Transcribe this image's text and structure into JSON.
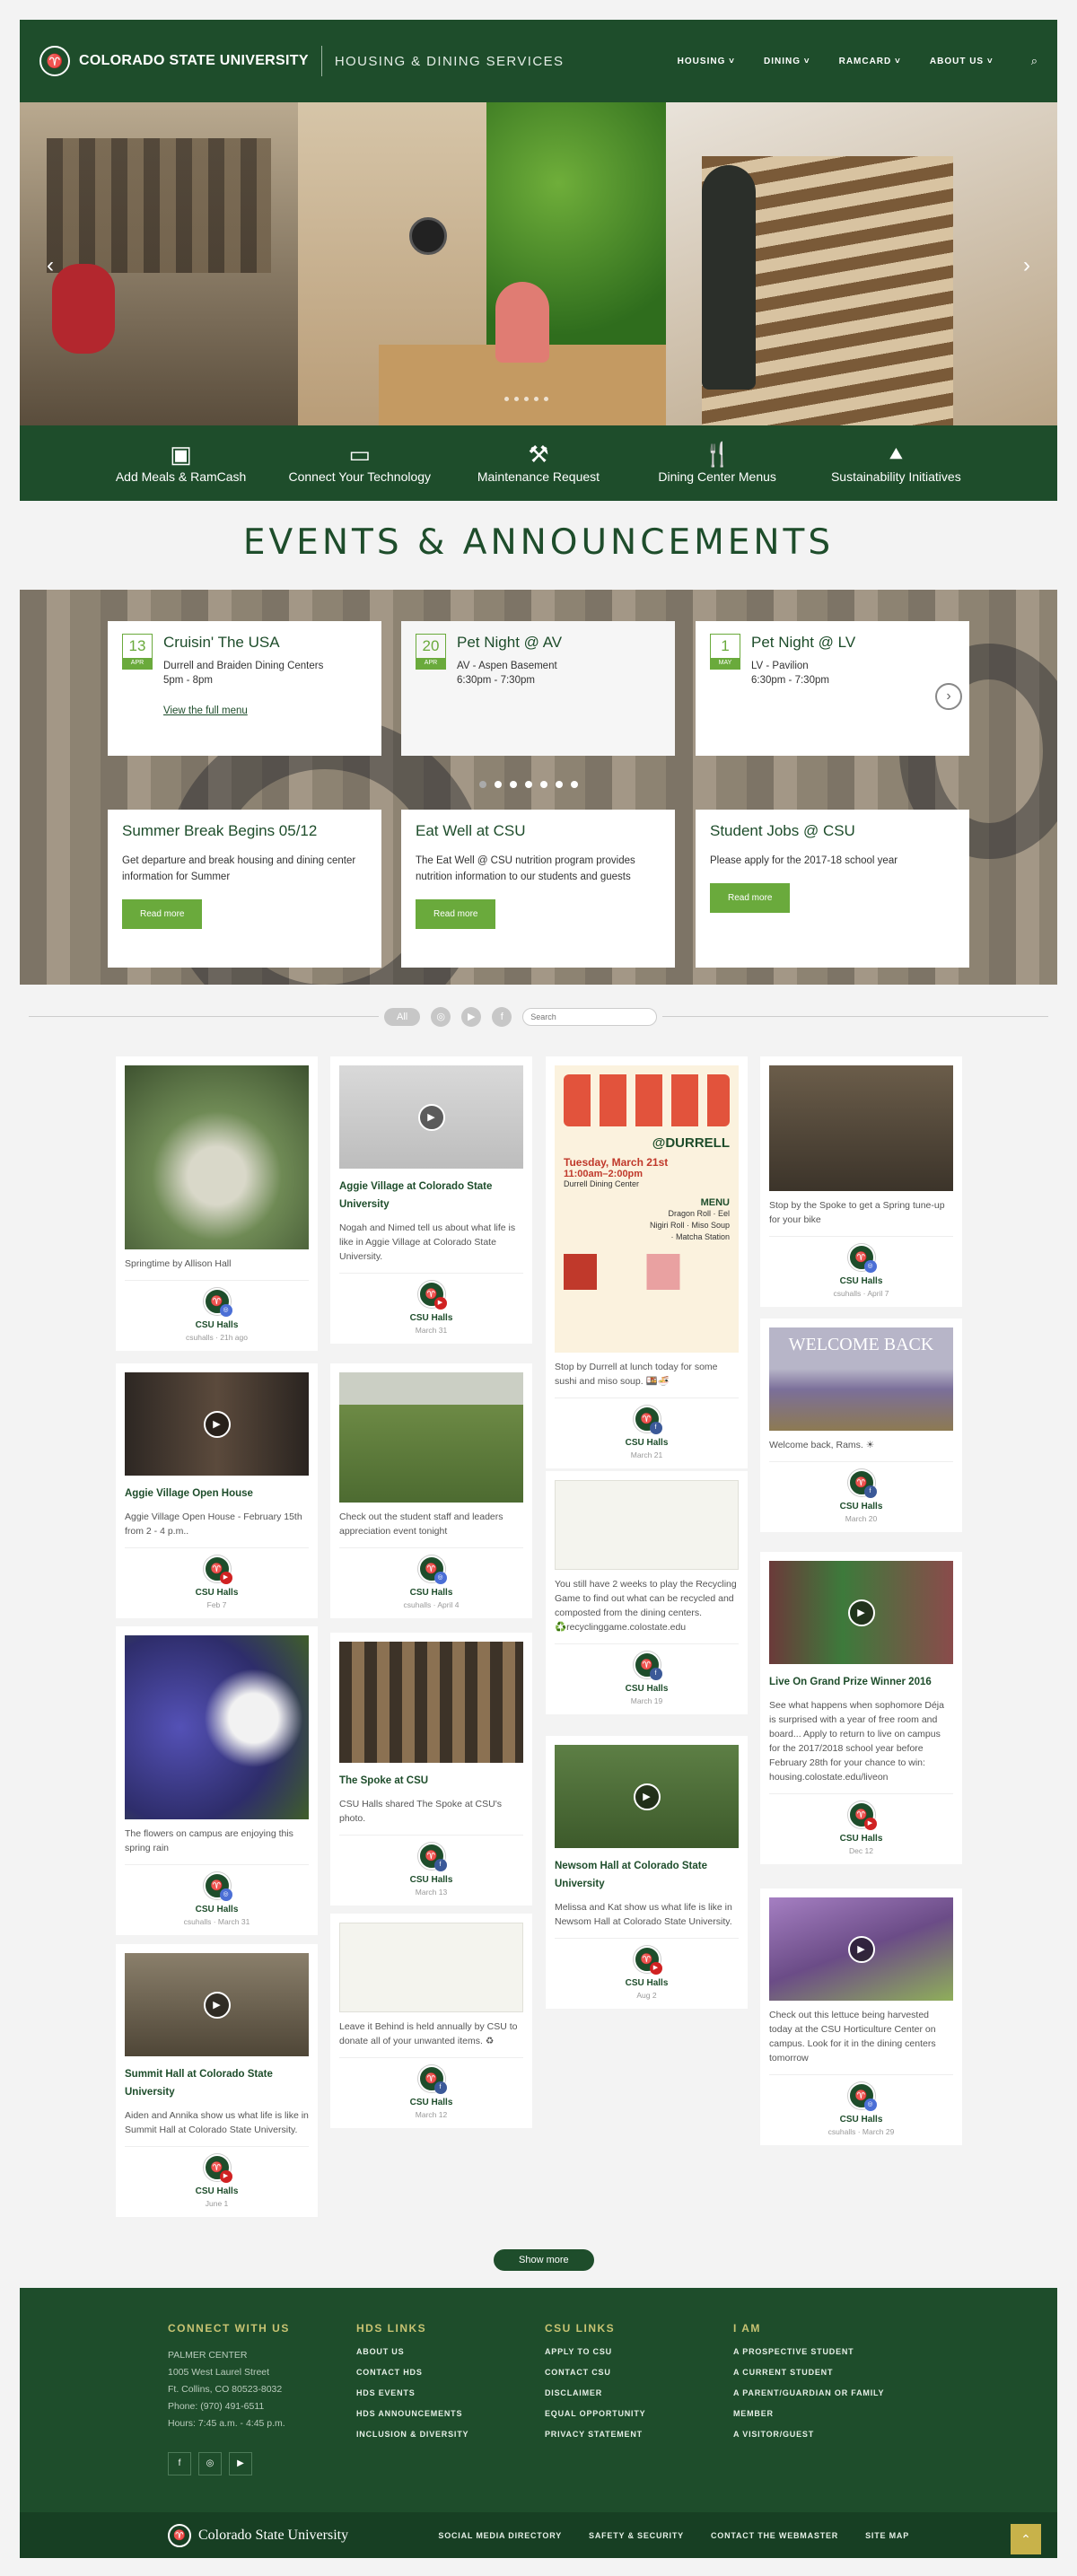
{
  "header": {
    "university": "COLORADO STATE UNIVERSITY",
    "department": "HOUSING & DINING SERVICES",
    "nav": [
      "HOUSING ˅",
      "DINING ˅",
      "RAMCARD ˅",
      "ABOUT US ˅"
    ],
    "logo_icon": "ram-logo",
    "search_icon": "search-icon"
  },
  "hero": {
    "prev_icon": "chevron-left-icon",
    "next_icon": "chevron-right-icon"
  },
  "quick_links": [
    {
      "label": "Add Meals & RamCash",
      "icon": "id-card-icon"
    },
    {
      "label": "Connect Your Technology",
      "icon": "monitor-icon"
    },
    {
      "label": "Maintenance Request",
      "icon": "wrench-icon"
    },
    {
      "label": "Dining Center Menus",
      "icon": "fork-knife-icon"
    },
    {
      "label": "Sustainability Initiatives",
      "icon": "tree-icon"
    }
  ],
  "events": {
    "title": "EVENTS & ANNOUNCEMENTS",
    "items": [
      {
        "day": "13",
        "month": "APR",
        "title": "Cruisin' The USA",
        "line1": "Durrell and Braiden Dining Centers",
        "line2": "5pm - 8pm",
        "link": "View the full menu"
      },
      {
        "day": "20",
        "month": "APR",
        "title": "Pet Night @ AV",
        "line1": "AV - Aspen Basement",
        "line2": "6:30pm - 7:30pm"
      },
      {
        "day": "1",
        "month": "MAY",
        "title": "Pet Night @ LV",
        "line1": "LV - Pavilion",
        "line2": "6:30pm - 7:30pm"
      }
    ],
    "announcements": [
      {
        "title": "Summer Break Begins 05/12",
        "text": "Get departure and break housing and dining center information for Summer",
        "button": "Read more"
      },
      {
        "title": "Eat Well at CSU",
        "text": "The Eat Well @ CSU nutrition program provides nutrition information to our students and guests",
        "button": "Read more"
      },
      {
        "title": "Student Jobs @ CSU",
        "text": "Please apply for the 2017-18 school year",
        "button": "Read more"
      }
    ]
  },
  "filters": {
    "all": "All",
    "search_placeholder": "Search"
  },
  "posts": [
    {
      "text": "Springtime by Allison Hall",
      "author": "CSU Halls",
      "meta": "csuhalls · 21h ago",
      "net": "instagram",
      "bg": "#6f8a55"
    },
    {
      "title": "Aggie Village Open House",
      "text": "Aggie Village Open House - February 15th from 2 - 4 p.m..",
      "author": "CSU Halls",
      "meta": "Feb 7",
      "net": "youtube",
      "bg": "#3b3631"
    },
    {
      "text": "The flowers on campus are enjoying this spring rain",
      "author": "CSU Halls",
      "meta": "csuhalls · March 31",
      "net": "instagram",
      "bg": "#4b4aa0"
    },
    {
      "title": "Summit Hall at Colorado State University",
      "text": "Aiden and Annika show us what life is like in Summit Hall at Colorado State University.",
      "author": "CSU Halls",
      "meta": "June 1",
      "net": "youtube",
      "bg": "#6b6251"
    },
    {
      "title": "Aggie Village at Colorado State University",
      "text": "Nogah and Nimed tell us about what life is like in Aggie Village at Colorado State University.",
      "author": "CSU Halls",
      "meta": "March 31",
      "net": "youtube",
      "bg": "#cfcfcf"
    },
    {
      "text": "Check out the student staff and leaders appreciation event tonight",
      "author": "CSU Halls",
      "meta": "csuhalls · April 4",
      "net": "instagram",
      "bg": "#5b7a3c"
    },
    {
      "title": "The Spoke at CSU",
      "text": "CSU Halls shared The Spoke at CSU's photo.",
      "author": "CSU Halls",
      "meta": "March 13",
      "net": "facebook",
      "bg": "#5e5040"
    },
    {
      "text": "Leave it Behind is held annually by CSU to donate all of your unwanted items. ♻",
      "author": "CSU Halls",
      "meta": "March 12",
      "net": "facebook",
      "bg": "#f4f4ee"
    },
    {
      "text": "Stop by Durrell at lunch today for some sushi and miso soup. 🍱🍜",
      "author": "CSU Halls",
      "meta": "March 21",
      "net": "facebook",
      "bg": "#fbf2de",
      "flyer_title": "@DURRELL",
      "flyer_date": "Tuesday, March 21st",
      "flyer_time": "11:00am–2:00pm",
      "flyer_place": "Durrell Dining Center",
      "flyer_menu": "MENU",
      "flyer_items": "Dragon Roll · Eel Nigiri Roll · Miso Soup · Matcha Station"
    },
    {
      "text": "You still have 2 weeks to play the Recycling Game to find out what can be recycled and composted from the dining centers. ♻️recyclinggame.colostate.edu",
      "author": "CSU Halls",
      "meta": "March 19",
      "net": "facebook",
      "bg": "#f4f4ee"
    },
    {
      "title": "Newsom Hall at Colorado State University",
      "text": "Melissa and Kat show us what life is like in Newsom Hall at Colorado State University.",
      "author": "CSU Halls",
      "meta": "Aug 2",
      "net": "youtube",
      "bg": "#4c6e3a"
    },
    {
      "text": "Stop by the Spoke to get a Spring tune-up for your bike",
      "author": "CSU Halls",
      "meta": "csuhalls · April 7",
      "net": "instagram",
      "bg": "#4b4236"
    },
    {
      "text": "Welcome back, Rams. ☀",
      "author": "CSU Halls",
      "meta": "March 20",
      "net": "facebook",
      "bg": "#8b87a8",
      "overlay": "WELCOME BACK"
    },
    {
      "title": "Live On Grand Prize Winner 2016",
      "text": "See what happens when sophomore Déja is surprised with a year of free room and board... Apply to return to live on campus for the 2017/2018 school year before February 28th for your chance to win: housing.colostate.edu/liveon",
      "author": "CSU Halls",
      "meta": "Dec 12",
      "net": "youtube",
      "bg": "#4e3d3a"
    },
    {
      "text": "Check out this lettuce being harvested today at the CSU Horticulture Center on campus. Look for it in the dining centers tomorrow",
      "author": "CSU Halls",
      "meta": "csuhalls · March 29",
      "net": "instagram",
      "bg": "#7c5c98"
    }
  ],
  "show_more": "Show more",
  "footer": {
    "connect": {
      "title": "CONNECT WITH US",
      "lines": [
        "PALMER CENTER",
        "1005 West Laurel Street",
        "Ft. Collins, CO 80523-8032",
        "Phone: (970) 491-6511",
        "Hours: 7:45 a.m. - 4:45 p.m."
      ]
    },
    "hds": {
      "title": "HDS LINKS",
      "links": [
        "ABOUT US",
        "CONTACT HDS",
        "HDS EVENTS",
        "HDS ANNOUNCEMENTS",
        "INCLUSION & DIVERSITY"
      ]
    },
    "csu": {
      "title": "CSU LINKS",
      "links": [
        "APPLY TO CSU",
        "CONTACT CSU",
        "DISCLAIMER",
        "EQUAL OPPORTUNITY",
        "PRIVACY STATEMENT"
      ]
    },
    "iam": {
      "title": "I AM",
      "links": [
        "A PROSPECTIVE STUDENT",
        "A CURRENT STUDENT",
        "A PARENT/GUARDIAN OR FAMILY",
        "MEMBER",
        "A VISITOR/GUEST"
      ]
    },
    "bottom_logo": "Colorado State University",
    "bottom_links": [
      "SOCIAL MEDIA DIRECTORY",
      "SAFETY & SECURITY",
      "CONTACT THE WEBMASTER",
      "SITE MAP"
    ]
  }
}
